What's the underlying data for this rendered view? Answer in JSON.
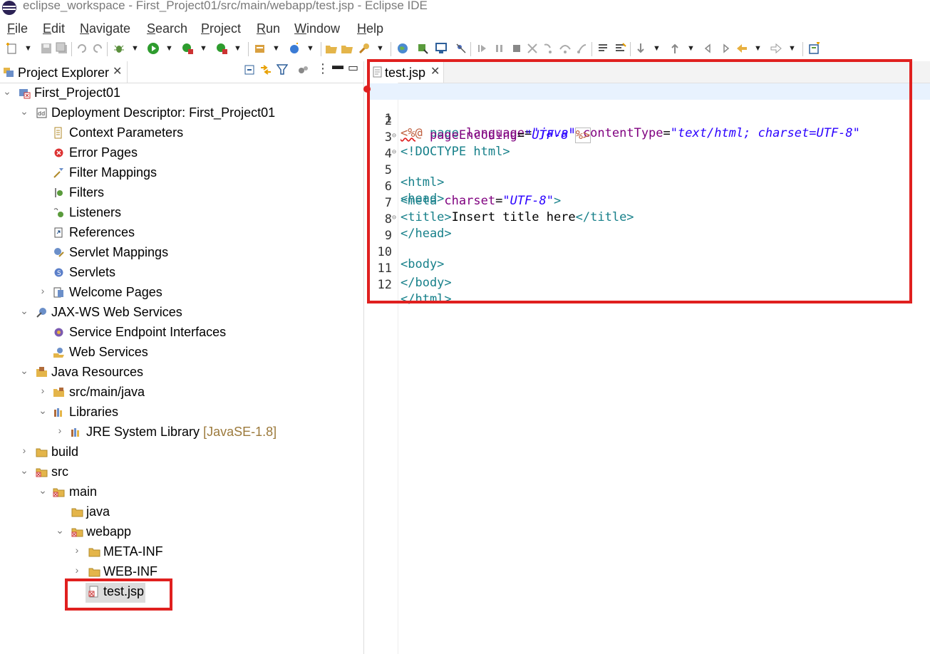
{
  "window": {
    "title": "eclipse_workspace - First_Project01/src/main/webapp/test.jsp - Eclipse IDE"
  },
  "menu": [
    "File",
    "Edit",
    "Navigate",
    "Search",
    "Project",
    "Run",
    "Window",
    "Help"
  ],
  "project_explorer": {
    "tab_label": "Project Explorer",
    "tree": [
      {
        "label": "First_Project01",
        "icon": "web-project-icon",
        "expanded": true
      },
      {
        "label": "Deployment Descriptor: First_Project01",
        "icon": "deployment-descriptor-icon",
        "expanded": true
      },
      {
        "label": "Context Parameters",
        "icon": "context-parameters-icon"
      },
      {
        "label": "Error Pages",
        "icon": "error-pages-icon"
      },
      {
        "label": "Filter Mappings",
        "icon": "filter-mappings-icon"
      },
      {
        "label": "Filters",
        "icon": "filters-icon"
      },
      {
        "label": "Listeners",
        "icon": "listeners-icon"
      },
      {
        "label": "References",
        "icon": "references-icon"
      },
      {
        "label": "Servlet Mappings",
        "icon": "servlet-mappings-icon"
      },
      {
        "label": "Servlets",
        "icon": "servlets-icon"
      },
      {
        "label": "Welcome Pages",
        "icon": "welcome-pages-icon",
        "expanded": false
      },
      {
        "label": "JAX-WS Web Services",
        "icon": "jaxws-icon",
        "expanded": true
      },
      {
        "label": "Service Endpoint Interfaces",
        "icon": "service-endpoint-icon"
      },
      {
        "label": "Web Services",
        "icon": "web-services-icon"
      },
      {
        "label": "Java Resources",
        "icon": "java-resources-icon",
        "expanded": true
      },
      {
        "label": "src/main/java",
        "icon": "source-folder-icon",
        "expanded": false
      },
      {
        "label": "Libraries",
        "icon": "libraries-icon",
        "expanded": true
      },
      {
        "label": "JRE System Library",
        "suffix": "[JavaSE-1.8]",
        "icon": "library-icon",
        "expanded": false
      },
      {
        "label": "build",
        "icon": "folder-icon",
        "expanded": false
      },
      {
        "label": "src",
        "icon": "folder-error-icon",
        "expanded": true
      },
      {
        "label": "main",
        "icon": "folder-error-icon",
        "expanded": true
      },
      {
        "label": "java",
        "icon": "folder-icon"
      },
      {
        "label": "webapp",
        "icon": "folder-error-icon",
        "expanded": true
      },
      {
        "label": "META-INF",
        "icon": "folder-icon",
        "expanded": false
      },
      {
        "label": "WEB-INF",
        "icon": "folder-icon",
        "expanded": false
      },
      {
        "label": "test.jsp",
        "icon": "jsp-file-error-icon",
        "selected": true
      }
    ]
  },
  "editor": {
    "tab_label": "test.jsp",
    "lines": [
      {
        "n": "1"
      },
      {
        "n": "2"
      },
      {
        "n": "3"
      },
      {
        "n": "4"
      },
      {
        "n": "5"
      },
      {
        "n": "6"
      },
      {
        "n": "7"
      },
      {
        "n": "8"
      },
      {
        "n": "9"
      },
      {
        "n": "10"
      },
      {
        "n": "11"
      },
      {
        "n": "12"
      }
    ],
    "tokens": {
      "l1_open": "<%@",
      "l1_page": " page",
      "l1_lang_attr": " language",
      "l1_eq": "=",
      "l1_lang_val": "\"java\"",
      "l1_ct_attr": " contentType",
      "l1_ct_val": "\"text/html; charset=UTF-8\"",
      "l2_indent": "    ",
      "l2_pe_attr": "pageEncoding",
      "l2_pe_val": "\"UTF-8\"",
      "l2_close": "%>",
      "l3_doctype": "<!DOCTYPE",
      "l3_html": " html",
      "l3_gt": ">",
      "l4": "<html>",
      "l5": "<head>",
      "l6_meta": "<meta",
      "l6_attr": " charset",
      "l6_val": "\"UTF-8\"",
      "l6_gt": ">",
      "l7_open": "<title>",
      "l7_text": "Insert title here",
      "l7_close": "</title>",
      "l8": "</head>",
      "l9": "<body>",
      "l11": "</body>",
      "l12": "</html>"
    }
  },
  "colors": {
    "highlight_box": "#e0201f",
    "tag": "#17808a",
    "attr": "#7f007f",
    "value": "#2a00ff"
  }
}
